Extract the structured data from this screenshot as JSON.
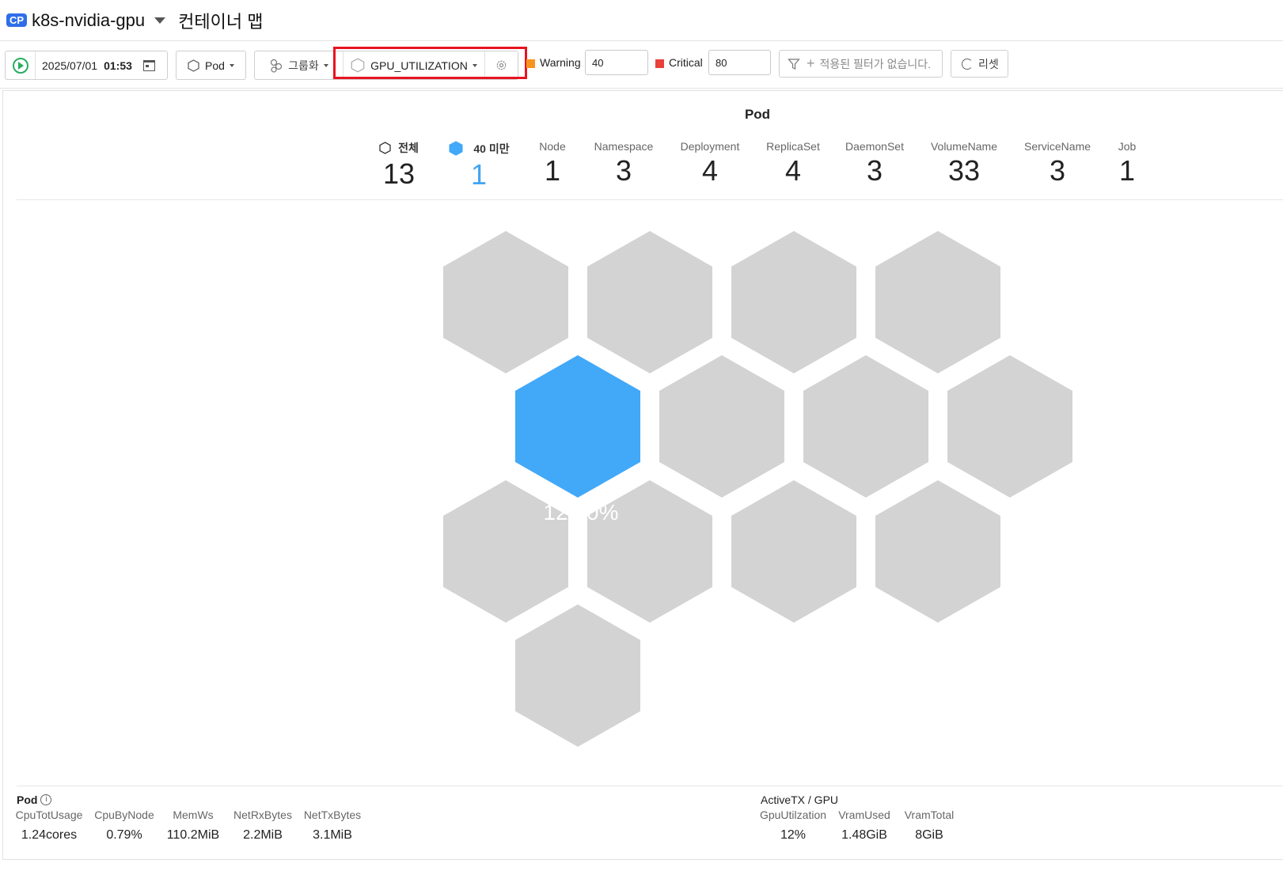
{
  "header": {
    "badge": "CP",
    "project": "k8s-nvidia-gpu",
    "title": "컨테이너 맵"
  },
  "toolbar": {
    "date": "2025/07/01",
    "time": "01:53",
    "object_type": "Pod",
    "group_label": "그룹화",
    "metric": "GPU_UTILIZATION",
    "warning_label": "Warning",
    "warning_value": "40",
    "critical_label": "Critical",
    "critical_value": "80",
    "filter_placeholder": "적용된 필터가 없습니다.",
    "reset_label": "리셋",
    "warning_color": "#f7941d",
    "critical_color": "#e8413a"
  },
  "panel": {
    "title": "Pod",
    "stats": [
      {
        "label": "전체",
        "value": "13"
      },
      {
        "label": "40 미만",
        "value": "1"
      },
      {
        "label": "Node",
        "value": "1"
      },
      {
        "label": "Namespace",
        "value": "3"
      },
      {
        "label": "Deployment",
        "value": "4"
      },
      {
        "label": "ReplicaSet",
        "value": "4"
      },
      {
        "label": "DaemonSet",
        "value": "3"
      },
      {
        "label": "VolumeName",
        "value": "33"
      },
      {
        "label": "ServiceName",
        "value": "3"
      },
      {
        "label": "Job",
        "value": "1"
      }
    ],
    "hexes": {
      "active_value": "12.00%",
      "active_color": "#42a8f8",
      "inactive_color": "#d3d3d3",
      "count": 13
    }
  },
  "metrics": {
    "pod_title": "Pod",
    "pod": [
      {
        "label": "CpuTotUsage",
        "value": "1.24cores"
      },
      {
        "label": "CpuByNode",
        "value": "0.79%"
      },
      {
        "label": "MemWs",
        "value": "110.2MiB"
      },
      {
        "label": "NetRxBytes",
        "value": "2.2MiB"
      },
      {
        "label": "NetTxBytes",
        "value": "3.1MiB"
      }
    ],
    "gpu_title": "ActiveTX / GPU",
    "gpu": [
      {
        "label": "GpuUtilzation",
        "value": "12%"
      },
      {
        "label": "VramUsed",
        "value": "1.48GiB"
      },
      {
        "label": "VramTotal",
        "value": "8GiB"
      }
    ]
  }
}
